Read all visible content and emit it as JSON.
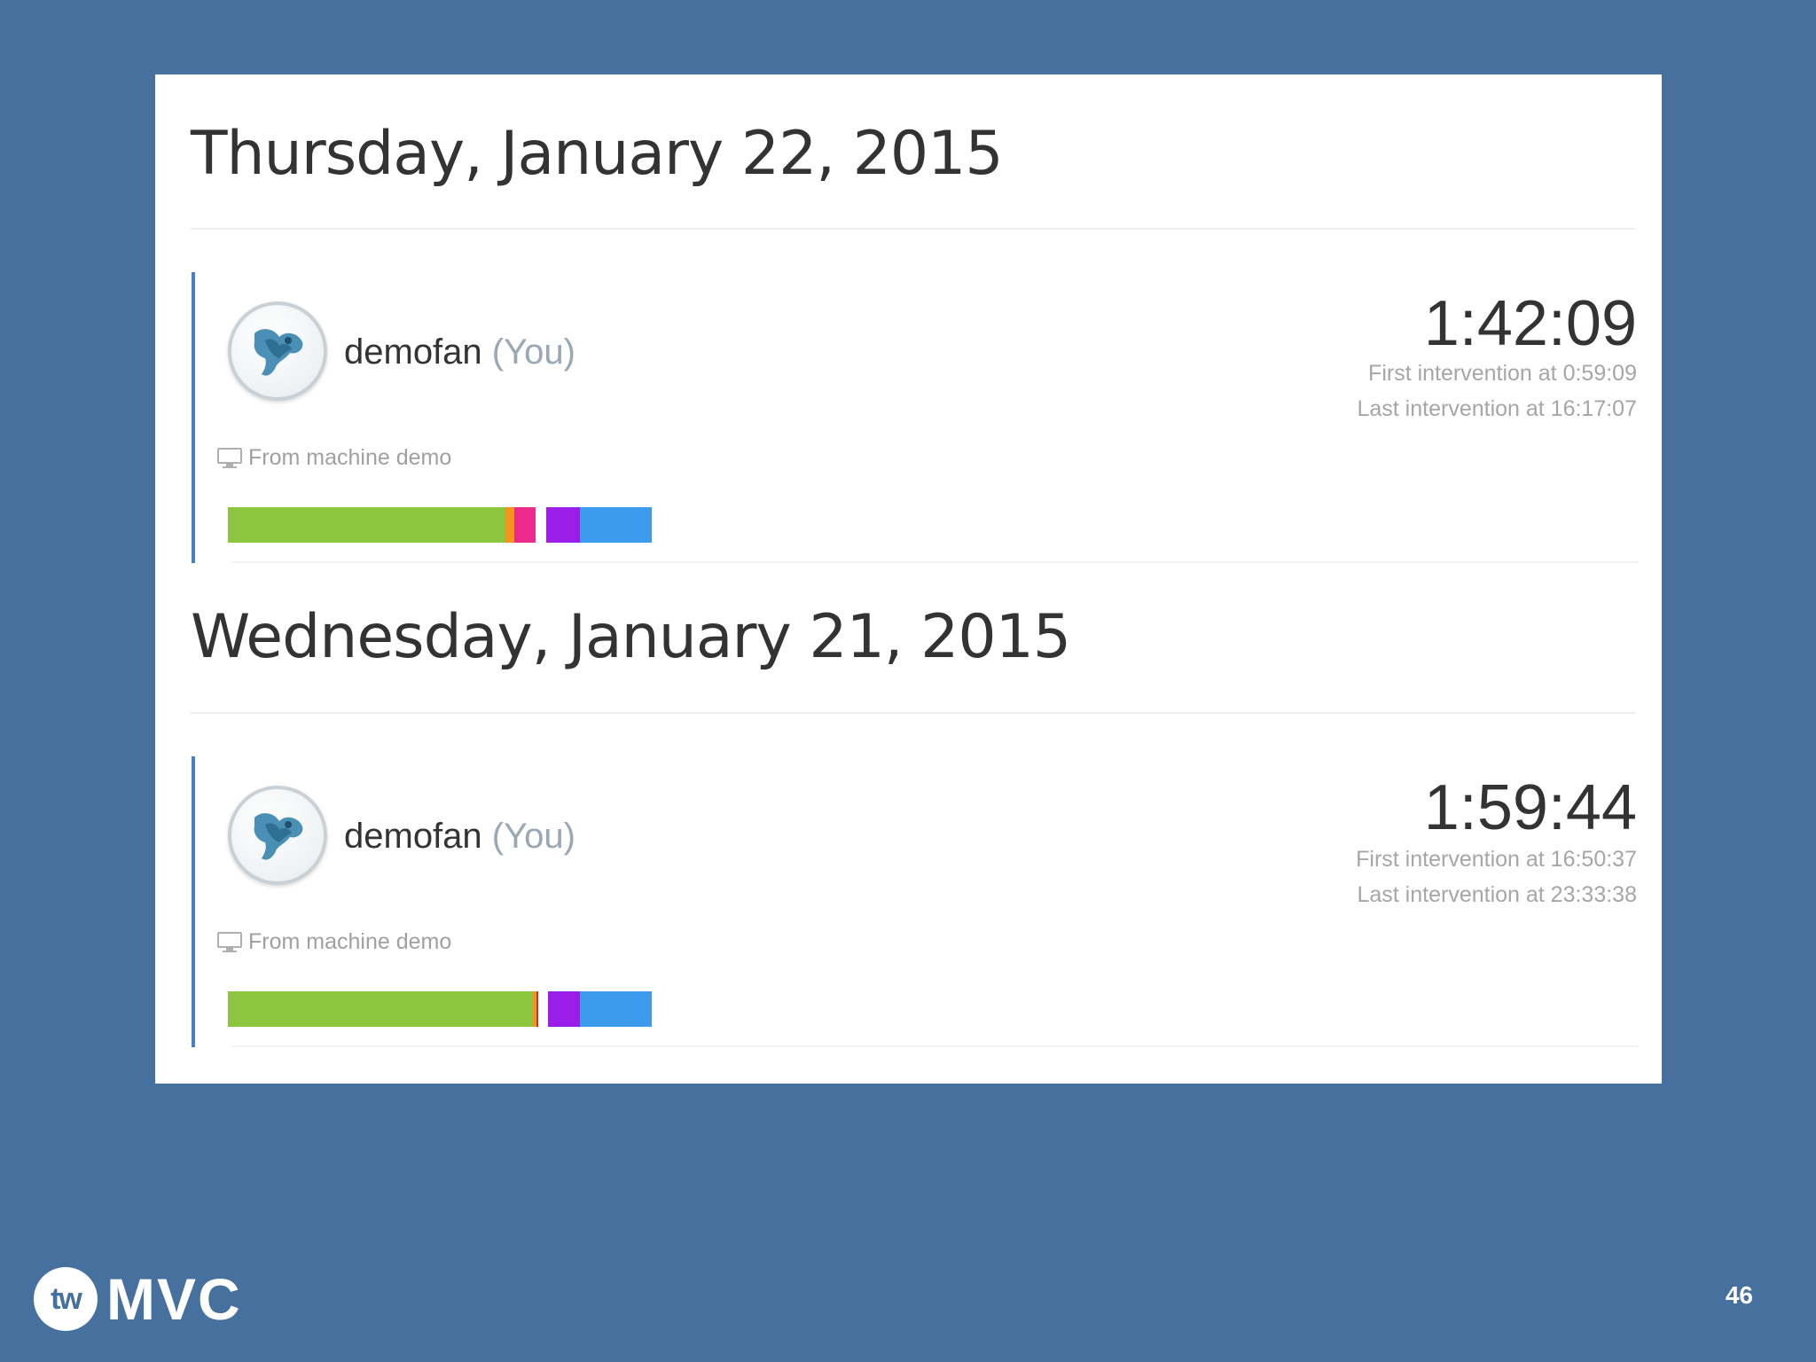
{
  "days": [
    {
      "date": "Thursday, January 22, 2015",
      "user": {
        "name": "demofan",
        "you": "(You)"
      },
      "machine": "From machine demo",
      "duration": "1:42:09",
      "first": "First intervention at 0:59:09",
      "last": "Last intervention at 16:17:07",
      "activity": [
        {
          "color": "#8cc63f",
          "from": 0.0,
          "to": 0.655
        },
        {
          "color": "#f7941d",
          "from": 0.655,
          "to": 0.675
        },
        {
          "color": "#ec2a8a",
          "from": 0.675,
          "to": 0.725
        },
        {
          "color": "#9b1de8",
          "from": 0.75,
          "to": 0.83
        },
        {
          "color": "#3d9bee",
          "from": 0.83,
          "to": 1.0
        }
      ]
    },
    {
      "date": "Wednesday, January 21, 2015",
      "user": {
        "name": "demofan",
        "you": "(You)"
      },
      "machine": "From machine demo",
      "duration": "1:59:44",
      "first": "First intervention at 16:50:37",
      "last": "Last intervention at 23:33:38",
      "activity": [
        {
          "color": "#8cc63f",
          "from": 0.0,
          "to": 0.72
        },
        {
          "color": "#f7941d",
          "from": 0.72,
          "to": 0.727
        },
        {
          "color": "#c0392b",
          "from": 0.727,
          "to": 0.733
        },
        {
          "color": "#9b1de8",
          "from": 0.755,
          "to": 0.83
        },
        {
          "color": "#3d9bee",
          "from": 0.83,
          "to": 1.0
        }
      ]
    }
  ],
  "icons": {
    "avatar": "bird-avatar-icon",
    "machine": "monitor-icon"
  },
  "footer": {
    "logo_mark": "tw",
    "logo_text": "MVC",
    "page_number": "46"
  }
}
